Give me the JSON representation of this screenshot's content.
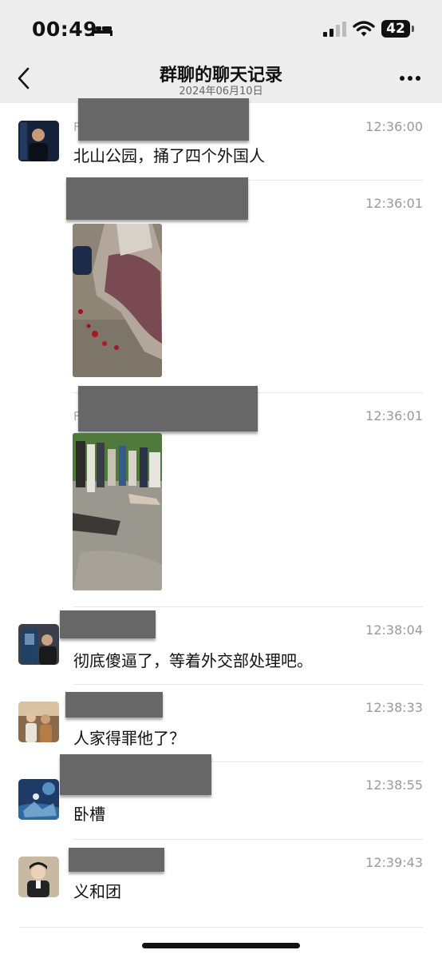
{
  "status_bar": {
    "time": "00:49",
    "battery": "42",
    "icons": [
      "bed-icon",
      "signal-icon",
      "wifi-icon",
      "battery-icon"
    ]
  },
  "nav": {
    "title": "群聊的聊天记录",
    "subtitle": "2024年06月10日",
    "icons": [
      "back-icon",
      "more-icon"
    ]
  },
  "messages": [
    {
      "name_initial": "F",
      "time": "12:36:00",
      "text": "北山公园，捅了四个外国人",
      "avatar": "avatar-icon"
    },
    {
      "time": "12:36:01",
      "image": "photo-injured-person"
    },
    {
      "name_initial": "F",
      "time": "12:36:01",
      "image": "photo-park-crowd"
    },
    {
      "time": "12:38:04",
      "text": "彻底傻逼了，等着外交部处理吧。",
      "avatar": "avatar-icon"
    },
    {
      "time": "12:38:33",
      "text": "人家得罪他了？",
      "avatar": "avatar-icon"
    },
    {
      "time": "12:38:55",
      "text": "卧槽",
      "avatar": "avatar-icon"
    },
    {
      "time": "12:39:43",
      "text": "义和团",
      "avatar": "avatar-icon"
    }
  ]
}
